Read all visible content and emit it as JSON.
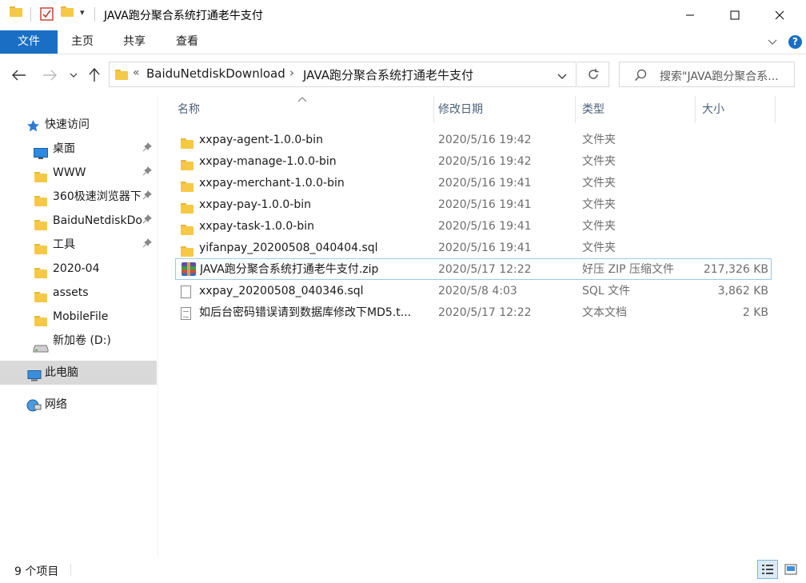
{
  "window": {
    "title": "JAVA跑分聚合系统打通老牛支付",
    "minimize": "—",
    "maximize": "☐",
    "close": "✕"
  },
  "ribbon": {
    "tabs": [
      "文件",
      "主页",
      "共享",
      "查看"
    ],
    "expand": "⌄",
    "help": "?"
  },
  "address": {
    "overflow": "«",
    "segments": [
      "BaiduNetdiskDownload",
      "JAVA跑分聚合系统打通老牛支付"
    ],
    "separator": "›",
    "search_placeholder": "搜索\"JAVA跑分聚合系..."
  },
  "nav": {
    "quick_access": "快速访问",
    "items": [
      {
        "label": "桌面",
        "pinned": true
      },
      {
        "label": "WWW",
        "pinned": true
      },
      {
        "label": "360极速浏览器下",
        "pinned": true
      },
      {
        "label": "BaiduNetdiskDownload",
        "pinned": true
      },
      {
        "label": "工具",
        "pinned": true
      },
      {
        "label": "2020-04",
        "pinned": false
      },
      {
        "label": "assets",
        "pinned": false
      },
      {
        "label": "MobileFile",
        "pinned": false
      },
      {
        "label": "新加卷 (D:)",
        "pinned": false
      }
    ],
    "this_pc": "此电脑",
    "network": "网络"
  },
  "columns": {
    "name": "名称",
    "date": "修改日期",
    "type": "类型",
    "size": "大小"
  },
  "files": [
    {
      "name": "xxpay-agent-1.0.0-bin",
      "date": "2020/5/16 19:42",
      "type": "文件夹",
      "size": "",
      "icon": "folder-icon"
    },
    {
      "name": "xxpay-manage-1.0.0-bin",
      "date": "2020/5/16 19:42",
      "type": "文件夹",
      "size": "",
      "icon": "folder-icon"
    },
    {
      "name": "xxpay-merchant-1.0.0-bin",
      "date": "2020/5/16 19:41",
      "type": "文件夹",
      "size": "",
      "icon": "folder-icon"
    },
    {
      "name": "xxpay-pay-1.0.0-bin",
      "date": "2020/5/16 19:41",
      "type": "文件夹",
      "size": "",
      "icon": "folder-icon"
    },
    {
      "name": "xxpay-task-1.0.0-bin",
      "date": "2020/5/16 19:41",
      "type": "文件夹",
      "size": "",
      "icon": "folder-icon"
    },
    {
      "name": "yifanpay_20200508_040404.sql",
      "date": "2020/5/16 19:41",
      "type": "文件夹",
      "size": "",
      "icon": "folder-icon"
    },
    {
      "name": "JAVA跑分聚合系统打通老牛支付.zip",
      "date": "2020/5/17 12:22",
      "type": "好压 ZIP 压缩文件",
      "size": "217,326 KB",
      "icon": "zip-archive-icon"
    },
    {
      "name": "xxpay_20200508_040346.sql",
      "date": "2020/5/8 4:03",
      "type": "SQL 文件",
      "size": "3,862 KB",
      "icon": "file-icon"
    },
    {
      "name": "如后台密码错误请到数据库修改下MD5.t...",
      "date": "2020/5/17 12:22",
      "type": "文本文档",
      "size": "2 KB",
      "icon": "text-file-icon"
    }
  ],
  "status": {
    "item_count": "9 个项目"
  },
  "colors": {
    "file_tab": "#1a6fc4",
    "selected_border": "#99c9ef",
    "nav_selected": "#d9d9d9",
    "folder": "#f5c945"
  }
}
